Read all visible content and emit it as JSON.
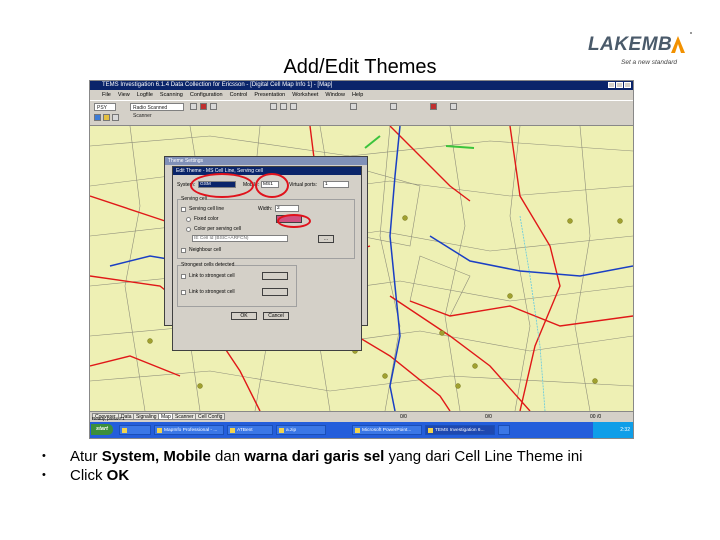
{
  "slide": {
    "title": "Add/Edit Themes",
    "logo": {
      "name": "LAKEMB",
      "mark_letter": "Λ",
      "tagline": "Set a new standard"
    },
    "bullets": [
      {
        "segments": [
          {
            "text": "Atur ",
            "bold": false
          },
          {
            "text": "System, Mobile",
            "bold": true
          },
          {
            "text": " dan ",
            "bold": false
          },
          {
            "text": "warna dari garis sel",
            "bold": true
          },
          {
            "text": " yang dari Cell Line Theme ini",
            "bold": false
          }
        ]
      },
      {
        "segments": [
          {
            "text": "Click ",
            "bold": false
          },
          {
            "text": "OK",
            "bold": true
          }
        ]
      }
    ]
  },
  "app": {
    "title": "TEMS Investigation 6.1.4 Data Collection for Ericsson - [Digital Cell Map Info 1] - [Map]",
    "menu": [
      "File",
      "View",
      "Logfile",
      "Scanning",
      "Configuration",
      "Control",
      "Presentation",
      "Worksheet",
      "Window",
      "Help"
    ],
    "toolbar": {
      "combo1": "PSY",
      "combo2": "Radio Scanned Scanner"
    },
    "tabs": [
      "Cooverer",
      "Data",
      "Signaling",
      "Map",
      "Scanner",
      "Cell Config"
    ],
    "status": "Ready, press F1",
    "coords": [
      "0/0",
      "0/0",
      "00 /0"
    ]
  },
  "taskbar": {
    "start": "start",
    "items": [
      "",
      "MapInfo Professional - ...",
      "ATBent",
      "a.zip",
      "Microsoft PowerPoint...",
      "TEMS Investigation 6...",
      ""
    ],
    "clock": "2:32"
  },
  "theme_settings": {
    "title": "Theme Settings"
  },
  "cell_line_dialog": {
    "title": "Edit Theme - MS Cell Line, Serving cell",
    "system_label": "System:",
    "system_value": "GSM",
    "mobile_label": "Mobile:",
    "mobile_value": "MS1",
    "virtual_ports_label": "Virtual ports:",
    "virtual_ports_value": "1",
    "serving_cell_group": "Serving cell",
    "serving_line_label": "Serving cell line",
    "width_label": "Width:",
    "width_value": "2",
    "fixed_color_label": "Fixed color",
    "color_per_label": "Color per serving cell",
    "ie_value": "IE Cell Id (BSIC+ARFCN)",
    "ok_label": "OK",
    "cancel_label": "Cancel",
    "neighbour_label": "Neighbour cell",
    "cell_group": "Strongest cells detected",
    "link_label_1": "Link to strongest cell",
    "link_label_2": "Link to strongest cell",
    "cell_btn": "..."
  },
  "colors": {
    "map_bg": "#eef0b4",
    "road": "#e01818",
    "route": "#1a3fc4",
    "highlight_ring": "#e0121c",
    "taskbar": "#245edb",
    "dialog_title": "#0a246a"
  }
}
